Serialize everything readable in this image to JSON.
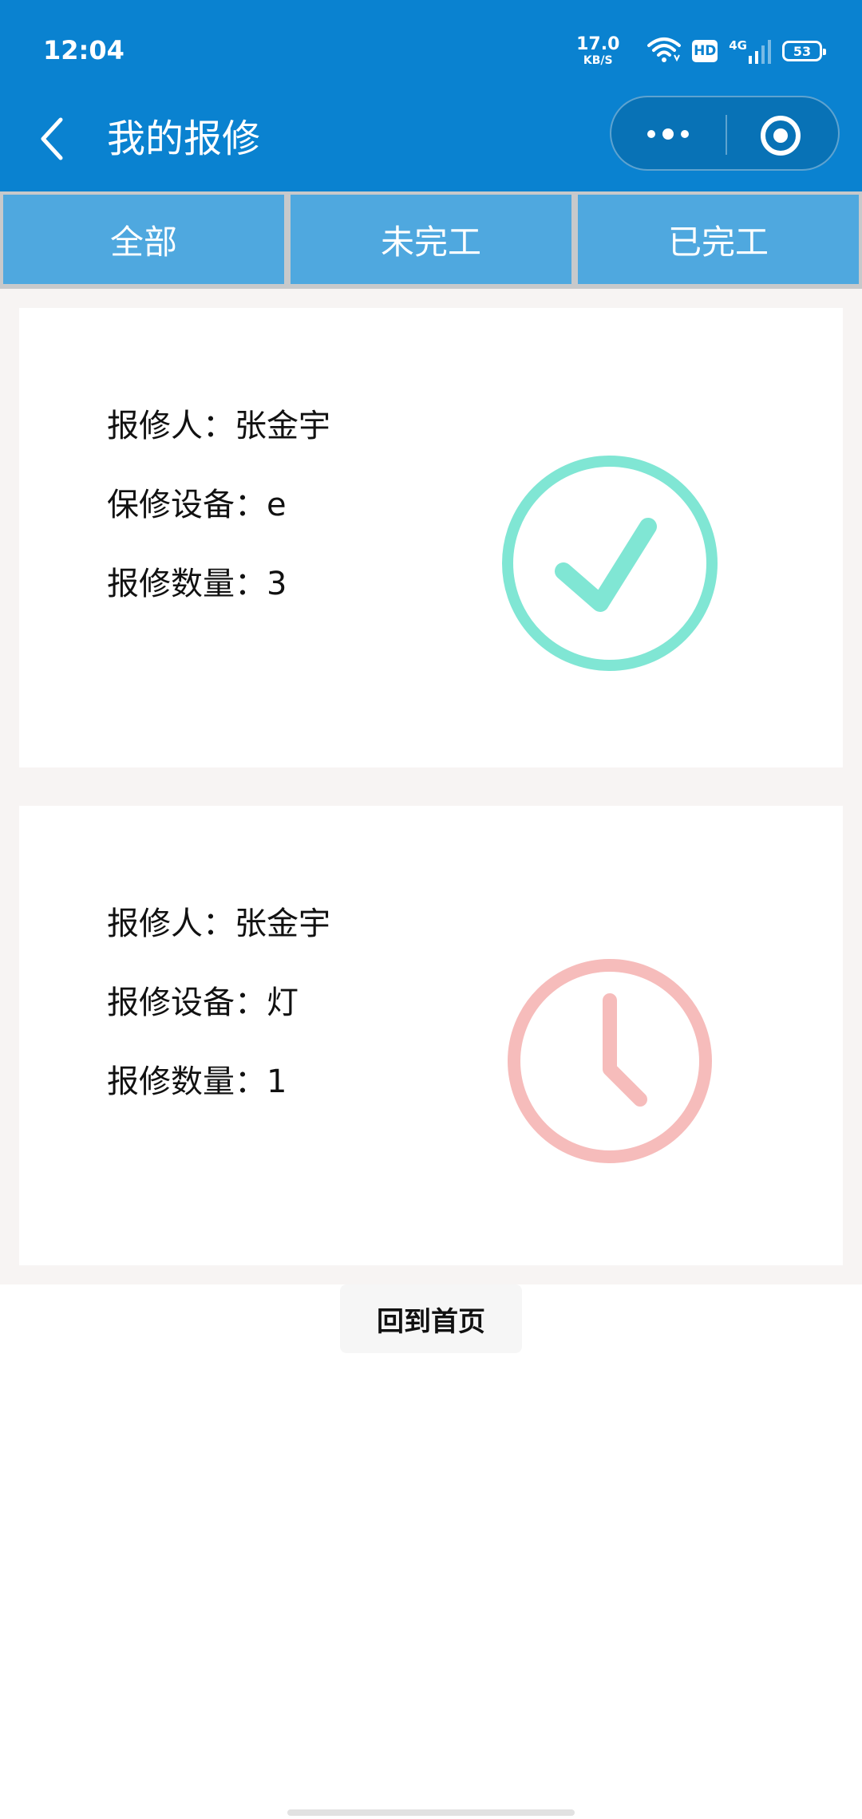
{
  "status_bar": {
    "time": "12:04",
    "net_speed_value": "17.0",
    "net_speed_unit": "KB/S",
    "hd_label": "HD",
    "network_label": "4G",
    "battery_level": "53"
  },
  "nav": {
    "title": "我的报修",
    "back_icon": "chevron-left-icon",
    "more_icon": "more-dots-icon",
    "close_icon": "target-icon"
  },
  "tabs": [
    {
      "label": "全部"
    },
    {
      "label": "未完工"
    },
    {
      "label": "已完工"
    }
  ],
  "repairs": [
    {
      "reporter": "报修人：张金宇",
      "device": "保修设备：e",
      "quantity": "报修数量：3",
      "status_icon": "check-circle-icon",
      "status_color": "#80e6d4"
    },
    {
      "reporter": "报修人：张金宇",
      "device": "报修设备：灯",
      "quantity": "报修数量：1",
      "status_icon": "clock-icon",
      "status_color": "#f6bcbb"
    }
  ],
  "home_button": {
    "label": "回到首页"
  },
  "colors": {
    "header": "#0a82d0",
    "tab_bg": "#4fa8df",
    "list_bg": "#f7f4f3"
  }
}
